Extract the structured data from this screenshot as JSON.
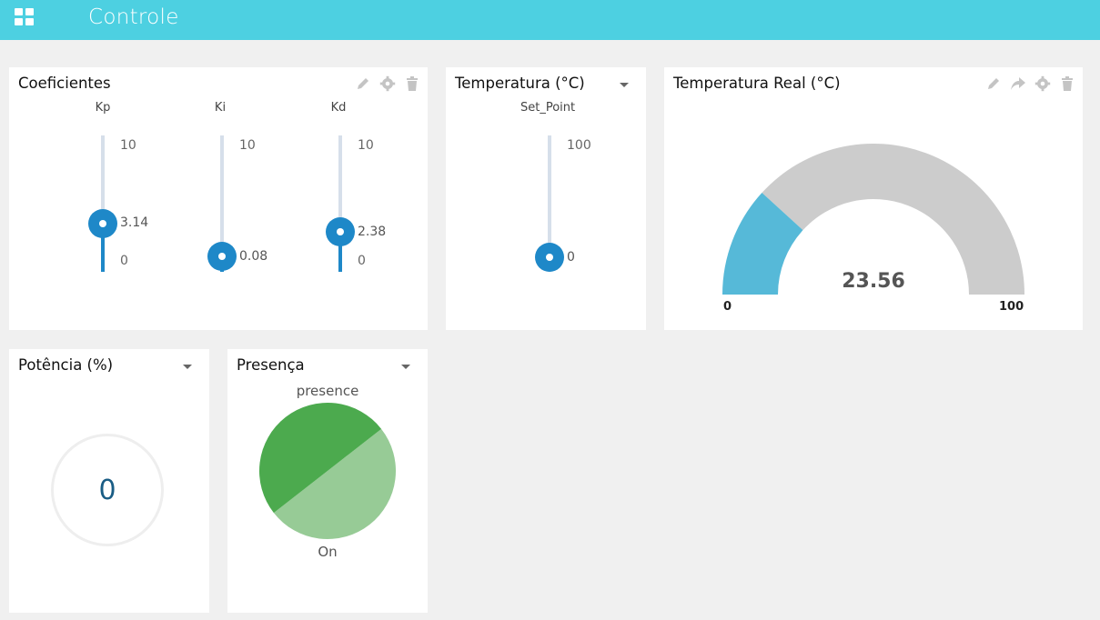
{
  "header": {
    "title": "Controle",
    "menu_icon": "grid-icon"
  },
  "coeficientes": {
    "title": "Coeficientes",
    "tools": [
      "pencil-icon",
      "gear-icon",
      "trash-icon"
    ],
    "sliders": [
      {
        "label": "Kp",
        "max": "10",
        "min": "0",
        "value": "3.14",
        "fraction": 0.314
      },
      {
        "label": "Ki",
        "max": "10",
        "min": "",
        "value": "0.08",
        "fraction": 0.008
      },
      {
        "label": "Kd",
        "max": "10",
        "min": "0",
        "value": "2.38",
        "fraction": 0.238
      }
    ]
  },
  "temperatura": {
    "title": "Temperatura (°C)",
    "slider": {
      "label": "Set_Point",
      "max": "100",
      "min": "",
      "value": "0",
      "fraction": 0
    }
  },
  "temperatura_real": {
    "title": "Temperatura Real (°C)",
    "tools": [
      "pencil-icon",
      "share-icon",
      "gear-icon",
      "trash-icon"
    ],
    "gauge": {
      "min": "0",
      "max": "100",
      "value": "23.56",
      "fraction": 0.2356,
      "fill_color": "#56b9d8",
      "track_color": "#cccccc"
    }
  },
  "potencia": {
    "title": "Potência (%)",
    "value": "0"
  },
  "presenca": {
    "title": "Presença",
    "series_label": "presence",
    "value_label": "On",
    "colors": {
      "dark": "#4caa4e",
      "light": "#97cb96"
    }
  }
}
